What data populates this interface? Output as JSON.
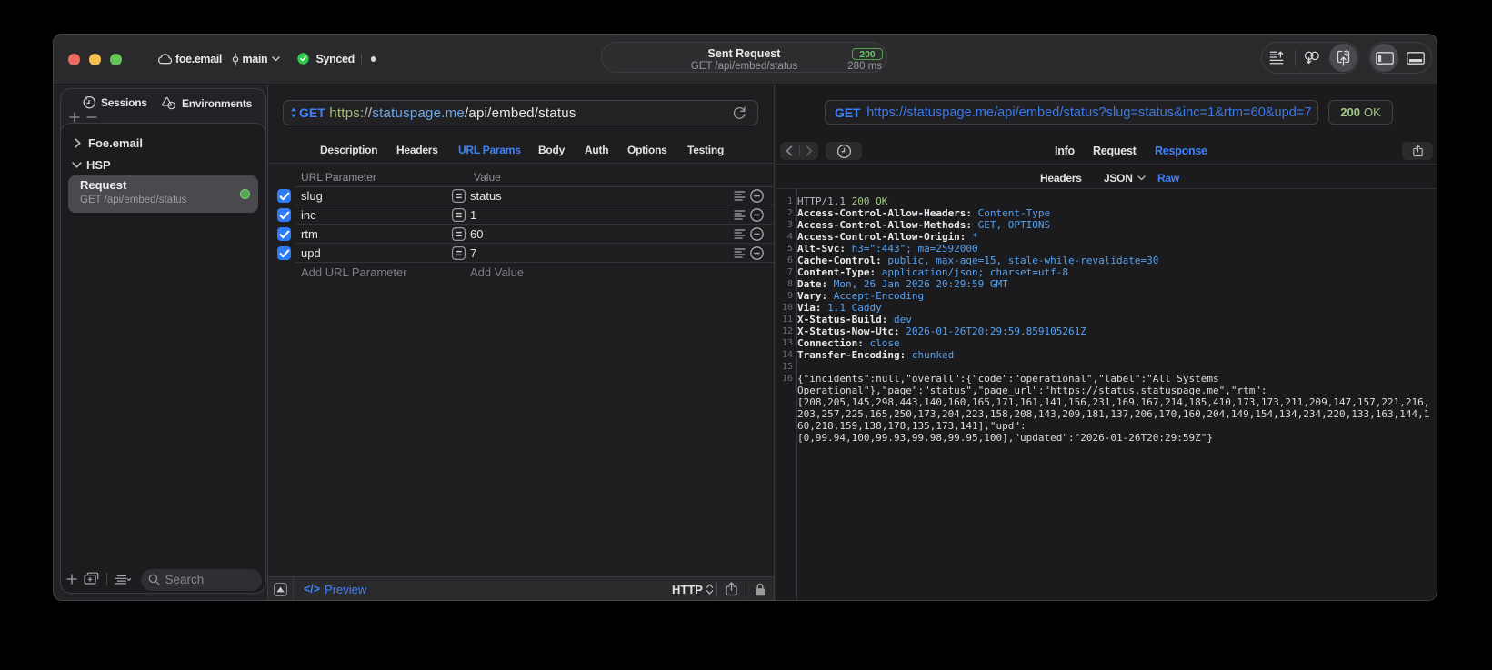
{
  "titlebar": {
    "project": "foe.email",
    "branch": "main",
    "sync_label": "Synced",
    "request_summary": {
      "title": "Sent Request",
      "subtitle": "GET /api/embed/status",
      "status_code": "200",
      "duration": "280 ms"
    }
  },
  "sidebar": {
    "tabs": [
      {
        "label": "Sessions",
        "icon": "history-icon"
      },
      {
        "label": "Environments",
        "icon": "environments-icon"
      }
    ],
    "groups": [
      {
        "label": "Foe.email",
        "expanded": false
      },
      {
        "label": "HSP",
        "expanded": true
      }
    ],
    "request_item": {
      "title": "Request",
      "subtitle": "GET /api/embed/status",
      "selected": true
    },
    "search_placeholder": "Search"
  },
  "request_editor": {
    "method": "GET",
    "url": {
      "scheme": "https",
      "separator": "://",
      "host": "statuspage.me",
      "path": "/api/embed/status"
    },
    "tabs": [
      {
        "label": "Description"
      },
      {
        "label": "Headers"
      },
      {
        "label": "URL Params",
        "active": true
      },
      {
        "label": "Body"
      },
      {
        "label": "Auth"
      },
      {
        "label": "Options"
      },
      {
        "label": "Testing"
      }
    ],
    "params": {
      "key_header": "URL Parameter",
      "value_header": "Value",
      "operator": "=",
      "rows": [
        {
          "key": "slug",
          "value": "status",
          "enabled": true
        },
        {
          "key": "inc",
          "value": "1",
          "enabled": true
        },
        {
          "key": "rtm",
          "value": "60",
          "enabled": true
        },
        {
          "key": "upd",
          "value": "7",
          "enabled": true
        }
      ],
      "add_key_placeholder": "Add URL Parameter",
      "add_value_placeholder": "Add Value"
    },
    "footer": {
      "code_glyph": "</>",
      "preview_label": "Preview",
      "protocol": "HTTP"
    }
  },
  "response_viewer": {
    "method": "GET",
    "url": "https://statuspage.me/api/embed/status?slug=status&inc=1&rtm=60&upd=7",
    "status_code": "200",
    "status_text": "OK",
    "tabs": [
      {
        "label": "Info"
      },
      {
        "label": "Request"
      },
      {
        "label": "Response",
        "active": true
      }
    ],
    "view_tabs": [
      {
        "label": "Headers"
      },
      {
        "label": "JSON",
        "has_menu": true
      },
      {
        "label": "Raw",
        "active": true
      }
    ],
    "raw": {
      "status_line": {
        "num": "1",
        "protocol": "HTTP/1.1 ",
        "status": "200 OK"
      },
      "headers": [
        {
          "num": "2",
          "name": "Access-Control-Allow-Headers:",
          "value": "Content-Type"
        },
        {
          "num": "3",
          "name": "Access-Control-Allow-Methods:",
          "value": "GET, OPTIONS"
        },
        {
          "num": "4",
          "name": "Access-Control-Allow-Origin:",
          "value": "*"
        },
        {
          "num": "5",
          "name": "Alt-Svc:",
          "value": "h3=\":443\"; ma=2592000"
        },
        {
          "num": "6",
          "name": "Cache-Control:",
          "value": "public, max-age=15, stale-while-revalidate=30"
        },
        {
          "num": "7",
          "name": "Content-Type:",
          "value": "application/json; charset=utf-8"
        },
        {
          "num": "8",
          "name": "Date:",
          "value": "Mon, 26 Jan 2026 20:29:59 GMT"
        },
        {
          "num": "9",
          "name": "Vary:",
          "value": "Accept-Encoding"
        },
        {
          "num": "10",
          "name": "Via:",
          "value": "1.1 Caddy"
        },
        {
          "num": "11",
          "name": "X-Status-Build:",
          "value": "dev"
        },
        {
          "num": "12",
          "name": "X-Status-Now-Utc:",
          "value": "2026-01-26T20:29:59.859105261Z"
        },
        {
          "num": "13",
          "name": "Connection:",
          "value": "close"
        },
        {
          "num": "14",
          "name": "Transfer-Encoding:",
          "value": "chunked"
        }
      ],
      "blank_line_num": "15",
      "body": {
        "num": "16",
        "lines": [
          "{\"incidents\":null,\"overall\":{\"code\":\"operational\",\"label\":\"All Systems",
          "Operational\"},\"page\":\"status\",\"page_url\":\"https://status.statuspage.me\",\"rtm\":",
          "[208,205,145,298,443,140,160,165,171,161,141,156,231,169,167,214,185,410,173,173,211,209,147,157,221,216,",
          "203,257,225,165,250,173,204,223,158,208,143,209,181,137,206,170,160,204,149,154,134,234,220,133,163,144,1",
          "60,218,159,138,178,135,173,141],\"upd\":",
          "[0,99.94,100,99.93,99.98,99.95,100],\"updated\":\"2026-01-26T20:29:59Z\"}"
        ]
      }
    }
  },
  "icons": {
    "titlebar": [
      "cloud-icon",
      "git-commit-icon",
      "chevron-down-icon",
      "synced-check-icon",
      "status-dot",
      "export-list-icon",
      "pull-loops-icon",
      "send-receive-icon",
      "panel-left-icon",
      "panel-bottom-icon"
    ],
    "sidebar": [
      "history-icon",
      "environments-icon",
      "plus-icon",
      "minus-icon",
      "chevron-right-icon",
      "chevron-down-icon",
      "new-folder-icon",
      "list-options-icon",
      "search-icon"
    ],
    "request_editor": [
      "method-stepper-icon",
      "refresh-icon",
      "checkbox-check-icon",
      "equals-operator-icon",
      "multiline-value-icon",
      "remove-param-icon",
      "expand-panel-icon",
      "code-icon",
      "protocol-updown-icon",
      "share-icon",
      "lock-icon"
    ],
    "response_viewer": [
      "back-icon",
      "forward-icon",
      "clock-icon",
      "share-icon",
      "json-menu-chevron-icon"
    ]
  },
  "colors": {
    "accent_blue": "#3f82f7",
    "url_blue": "#3d79e8",
    "host_blue": "#6ea7e8",
    "scheme_green": "#a3bd74",
    "status_green": "#a3ca85",
    "badge_green": "#68c564",
    "sync_green": "#2fcb46",
    "checkbox_blue": "#2e7cf6",
    "traffic_red": "#ee6a5f",
    "traffic_yellow": "#f5bf4f",
    "traffic_green": "#62c554"
  }
}
